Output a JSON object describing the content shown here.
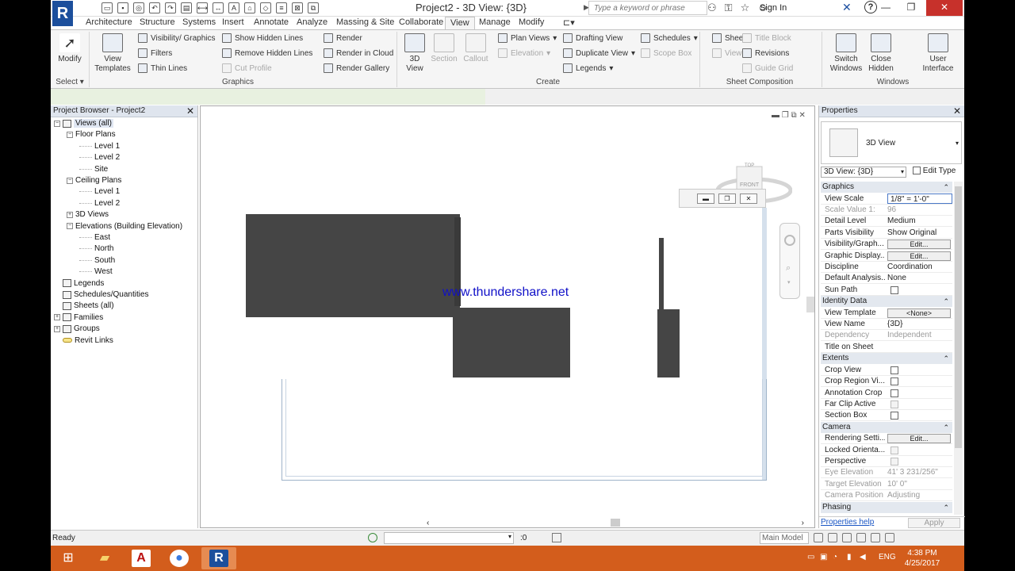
{
  "title": "Project2 - 3D View: {3D}",
  "search": {
    "placeholder": "Type a keyword or phrase"
  },
  "signin": "Sign In",
  "logo": "R",
  "help": "?",
  "window_controls": {
    "minimize": "—",
    "restore": "❐",
    "close": "✕"
  },
  "tabs": [
    "Architecture",
    "Structure",
    "Systems",
    "Insert",
    "Annotate",
    "Analyze",
    "Massing & Site",
    "Collaborate",
    "View",
    "Manage",
    "Modify"
  ],
  "active_tab": "View",
  "ribbon": {
    "modify": "Modify",
    "select": "Select ▾",
    "view_templates_1": "View",
    "view_templates_2": "Templates",
    "visibility_graphics": "Visibility/ Graphics",
    "filters": "Filters",
    "thin_lines": "Thin Lines",
    "show_hidden_lines": "Show  Hidden Lines",
    "remove_hidden_lines": "Remove  Hidden Lines",
    "cut_profile": "Cut  Profile",
    "render": "Render",
    "render_in_cloud": "Render  in Cloud",
    "render_gallery": "Render  Gallery",
    "graphics_panel": "Graphics",
    "view_3d_1": "3D",
    "view_3d_2": "View",
    "section": "Section",
    "callout": "Callout",
    "plan_views": "Plan  Views",
    "elevation": "Elevation",
    "drafting_view": "Drafting  View",
    "duplicate_view": "Duplicate  View",
    "legends": "Legends",
    "schedules": "Schedules",
    "scope_box": "Scope  Box",
    "create_panel": "Create",
    "sheet": "Sheet",
    "view": "View",
    "title_block": "Title  Block",
    "revisions": "Revisions",
    "guide_grid": "Guide  Grid",
    "sheet_comp_panel": "Sheet Composition",
    "switch_windows_1": "Switch",
    "switch_windows_2": "Windows",
    "close_hidden_1": "Close",
    "close_hidden_2": "Hidden",
    "user_interface_1": "User",
    "user_interface_2": "Interface",
    "windows_panel": "Windows"
  },
  "project_browser": {
    "header": "Project Browser - Project2",
    "close": "✕",
    "items": [
      {
        "label": "Views (all)",
        "level": 0,
        "expand": "−"
      },
      {
        "label": "Floor Plans",
        "level": 1,
        "expand": "−"
      },
      {
        "label": "Level 1",
        "level": 2
      },
      {
        "label": "Level 2",
        "level": 2
      },
      {
        "label": "Site",
        "level": 2
      },
      {
        "label": "Ceiling Plans",
        "level": 1,
        "expand": "−"
      },
      {
        "label": "Level 1",
        "level": 2
      },
      {
        "label": "Level 2",
        "level": 2
      },
      {
        "label": "3D Views",
        "level": 1,
        "expand": "+"
      },
      {
        "label": "Elevations (Building Elevation)",
        "level": 1,
        "expand": "−"
      },
      {
        "label": "East",
        "level": 2
      },
      {
        "label": "North",
        "level": 2
      },
      {
        "label": "South",
        "level": 2
      },
      {
        "label": "West",
        "level": 2
      },
      {
        "label": "Legends",
        "level": 0
      },
      {
        "label": "Schedules/Quantities",
        "level": 0
      },
      {
        "label": "Sheets (all)",
        "level": 0
      },
      {
        "label": "Families",
        "level": 0,
        "expand": "+"
      },
      {
        "label": "Groups",
        "level": 0,
        "expand": "+"
      },
      {
        "label": "Revit Links",
        "level": 0
      }
    ]
  },
  "canvas": {
    "watermark": "www.thundershare.net",
    "viewcube_top": "TOP",
    "viewcube_front": "FRONT"
  },
  "properties": {
    "header": "Properties",
    "close": "✕",
    "type_name": "3D View",
    "selector": "3D View: {3D}",
    "edit_type": "Edit Type",
    "groups": [
      {
        "name": "Graphics",
        "rows": [
          {
            "k": "View Scale",
            "v": "1/8\" = 1'-0\"",
            "kind": "input"
          },
          {
            "k": "Scale Value    1:",
            "v": "96",
            "kind": "dis"
          },
          {
            "k": "Detail Level",
            "v": "Medium"
          },
          {
            "k": "Parts Visibility",
            "v": "Show Original"
          },
          {
            "k": "Visibility/Graph...",
            "v": "Edit...",
            "kind": "btn"
          },
          {
            "k": "Graphic Display...",
            "v": "Edit...",
            "kind": "btn"
          },
          {
            "k": "Discipline",
            "v": "Coordination"
          },
          {
            "k": "Default Analysis...",
            "v": "None"
          },
          {
            "k": "Sun Path",
            "v": "",
            "kind": "chk"
          }
        ]
      },
      {
        "name": "Identity Data",
        "rows": [
          {
            "k": "View Template",
            "v": "<None>",
            "kind": "btn"
          },
          {
            "k": "View Name",
            "v": "{3D}"
          },
          {
            "k": "Dependency",
            "v": "Independent",
            "kind": "dis"
          },
          {
            "k": "Title on Sheet",
            "v": ""
          }
        ]
      },
      {
        "name": "Extents",
        "rows": [
          {
            "k": "Crop View",
            "v": "",
            "kind": "chk"
          },
          {
            "k": "Crop Region Vi...",
            "v": "",
            "kind": "chk"
          },
          {
            "k": "Annotation Crop",
            "v": "",
            "kind": "chk"
          },
          {
            "k": "Far Clip Active",
            "v": "",
            "kind": "chkdis"
          },
          {
            "k": "Section Box",
            "v": "",
            "kind": "chk"
          }
        ]
      },
      {
        "name": "Camera",
        "rows": [
          {
            "k": "Rendering Setti...",
            "v": "Edit...",
            "kind": "btn"
          },
          {
            "k": "Locked Orienta...",
            "v": "",
            "kind": "chkdis"
          },
          {
            "k": "Perspective",
            "v": "",
            "kind": "chkdis"
          },
          {
            "k": "Eye Elevation",
            "v": "41'  3 231/256\"",
            "kind": "dis"
          },
          {
            "k": "Target Elevation",
            "v": "10'  0\"",
            "kind": "dis"
          },
          {
            "k": "Camera Position",
            "v": "Adjusting",
            "kind": "dis"
          }
        ]
      },
      {
        "name": "Phasing",
        "rows": []
      }
    ],
    "help_link": "Properties help",
    "apply": "Apply"
  },
  "status": {
    "ready": "Ready",
    "zero": ":0",
    "model": "Main Model"
  },
  "taskbar": {
    "lang": "ENG",
    "time": "4:38 PM",
    "date": "4/25/2017"
  }
}
